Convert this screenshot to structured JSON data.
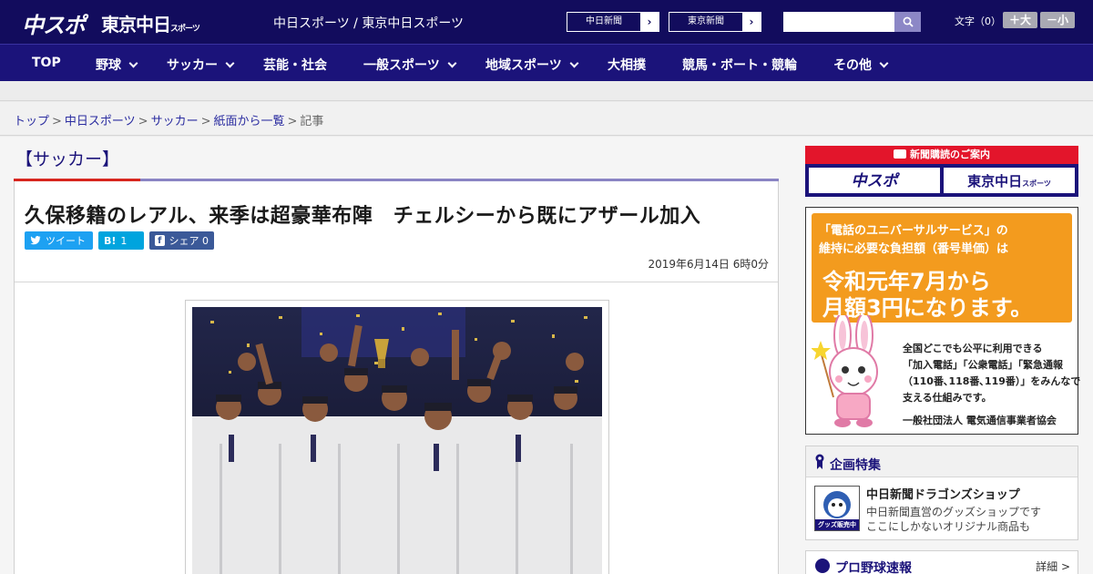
{
  "header": {
    "logo_chuspo": "中スポ",
    "logo_tokyo": "東京中日",
    "logo_tokyo_small": "スポーツ",
    "site_name": "中日スポーツ / 東京中日スポーツ",
    "ext_links": [
      {
        "label": "中日新聞",
        "arrow": "›"
      },
      {
        "label": "東京新聞",
        "arrow": "›"
      }
    ],
    "search_placeholder": "",
    "fontsize_label": "文字（0）",
    "fontsize_plus": "＋大",
    "fontsize_minus": "－小"
  },
  "nav": {
    "items": [
      {
        "label": "TOP",
        "dropdown": false
      },
      {
        "label": "野球",
        "dropdown": true
      },
      {
        "label": "サッカー",
        "dropdown": true
      },
      {
        "label": "芸能・社会",
        "dropdown": false
      },
      {
        "label": "一般スポーツ",
        "dropdown": true
      },
      {
        "label": "地域スポーツ",
        "dropdown": true
      },
      {
        "label": "大相撲",
        "dropdown": false
      },
      {
        "label": "競馬・ボート・競輪",
        "dropdown": false
      },
      {
        "label": "その他",
        "dropdown": true
      }
    ]
  },
  "breadcrumb": {
    "items": [
      "トップ",
      "中日スポーツ",
      "サッカー",
      "紙面から一覧"
    ],
    "sep": ">",
    "current": "記事"
  },
  "article": {
    "category": "【サッカー】",
    "headline": "久保移籍のレアル、来季は超豪華布陣　チェルシーから既にアザール加入",
    "share": {
      "tweet": "ツイート",
      "hatena_icon": "B!",
      "hatena_count": "1",
      "fb_icon": "f",
      "fb_label": "シェア",
      "fb_count": "0"
    },
    "date": "2019年6月14日 6時0分"
  },
  "sidebar": {
    "subscribe": {
      "title": "新聞購読のご案内",
      "left": "中スポ",
      "right": "東京中日",
      "right_small": "スポーツ"
    },
    "universal_ad": {
      "line1": "「電話のユニバーサルサービス」の",
      "line2": "維持に必要な負担額（番号単価）は",
      "line3": "令和元年7月から",
      "line4": "月額3円になります。",
      "body": [
        "全国どこでも公平に利用できる",
        "「加入電話」「公衆電話」「緊急通報",
        "（110番､118番､119番）」をみんなで",
        "支える仕組みです。"
      ],
      "org": "一般社団法人 電気通信事業者協会"
    },
    "feature": {
      "title": "企画特集",
      "item_name": "中日新聞ドラゴンズショップ",
      "item_desc1": "中日新聞直営のグッズショップです",
      "item_desc2": "ここにしかないオリジナル商品も",
      "thumb_text": "グッズ販売中"
    },
    "score": {
      "title": "プロ野球速報",
      "more": "詳細 >"
    }
  },
  "colors": {
    "header": "#120c5d",
    "nav": "#1b137a",
    "accent_red": "#d7261e",
    "twitter": "#1da1f2",
    "hatena": "#00a4de",
    "facebook": "#3b5998",
    "ad_orange": "#f39b1e"
  }
}
